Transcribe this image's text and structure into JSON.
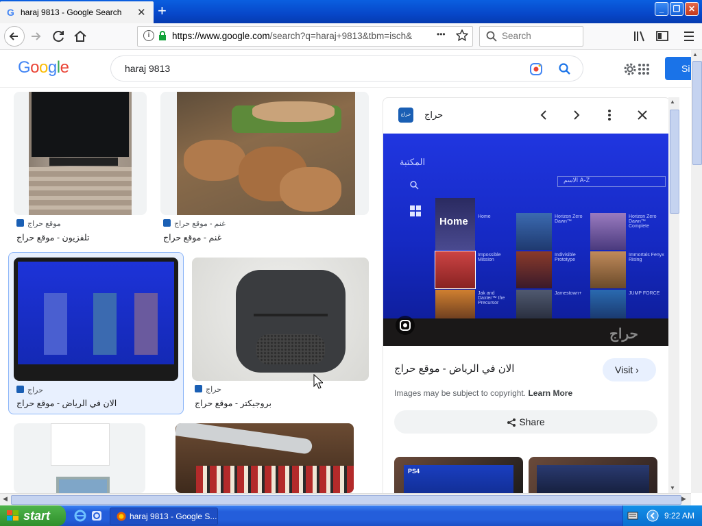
{
  "browser": {
    "tab_title": "haraj 9813 - Google Search",
    "tab_close": "✕",
    "new_tab": "+",
    "url_domain": "https://www.google.com",
    "url_rest": "/search?q=haraj+9813&tbm=isch&",
    "search_placeholder": "Search",
    "menu_dots": "•••"
  },
  "google": {
    "logo": "Google",
    "query": "haraj 9813",
    "signin": "Si"
  },
  "results": [
    {
      "source": "موقع حراج",
      "title": "تلفزيون - موقع حراج"
    },
    {
      "source": "غنم - موقع حراج",
      "title": "غنم - موقع حراج"
    },
    {
      "source": "حراج",
      "title": "الان في الرياض - موقع حراج"
    },
    {
      "source": "حراج",
      "title": "بروجيكتر - موقع حراج"
    }
  ],
  "panel": {
    "site_name": "حراج",
    "site_icon_text": "حراج",
    "title": "الان في الرياض - موقع حراج",
    "visit": "Visit",
    "copyright": "Images may be subject to copyright.",
    "learn_more": "Learn More",
    "share": "Share",
    "screen_header": "المكتبة",
    "screen_sort": "الاسم A-Z",
    "tiles": [
      "Home",
      "Horizon Zero Dawn™",
      "Horizon Zero Dawn™ Complete",
      "Impossible Mission",
      "Indivisible Prototype",
      "Immortals Fenyx Rising",
      "Jak and Daxter™ the Precursor",
      "Jamestown+",
      "JUMP FORCE"
    ],
    "watermark": "حراج",
    "ps4_label": "PS4"
  },
  "taskbar": {
    "start": "start",
    "task_item": "haraj 9813 - Google S...",
    "clock": "9:22 AM"
  },
  "colors": {
    "google_blue": "#4285f4",
    "google_red": "#ea4335",
    "google_yellow": "#fbbc05",
    "google_green": "#34a853",
    "signin_blue": "#1a73e8",
    "xp_blue": "#245edb",
    "start_green": "#3c9b37"
  }
}
